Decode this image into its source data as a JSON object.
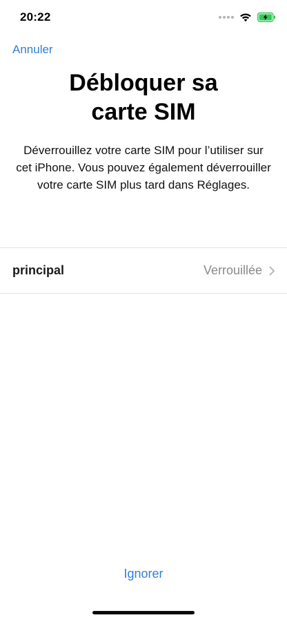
{
  "status_bar": {
    "time": "20:22",
    "icons": [
      "cellular-dots-icon",
      "wifi-icon",
      "battery-charging-icon"
    ]
  },
  "nav": {
    "cancel_label": "Annuler"
  },
  "header": {
    "title": "Débloquer sa\ncarte SIM",
    "description": "Déverrouillez votre carte SIM pour l’utiliser sur cet iPhone. Vous pouvez également déverrouiller votre carte SIM plus tard dans Réglages."
  },
  "sim_list": [
    {
      "name": "principal",
      "status": "Verrouillée",
      "icon": "chevron-right-icon"
    }
  ],
  "footer": {
    "ignore_label": "Ignorer"
  },
  "colors": {
    "link_blue": "#2f7fd6",
    "secondary_gray": "#8a8a8e",
    "battery_green": "#35c759",
    "separator": "#e3e3e6"
  }
}
